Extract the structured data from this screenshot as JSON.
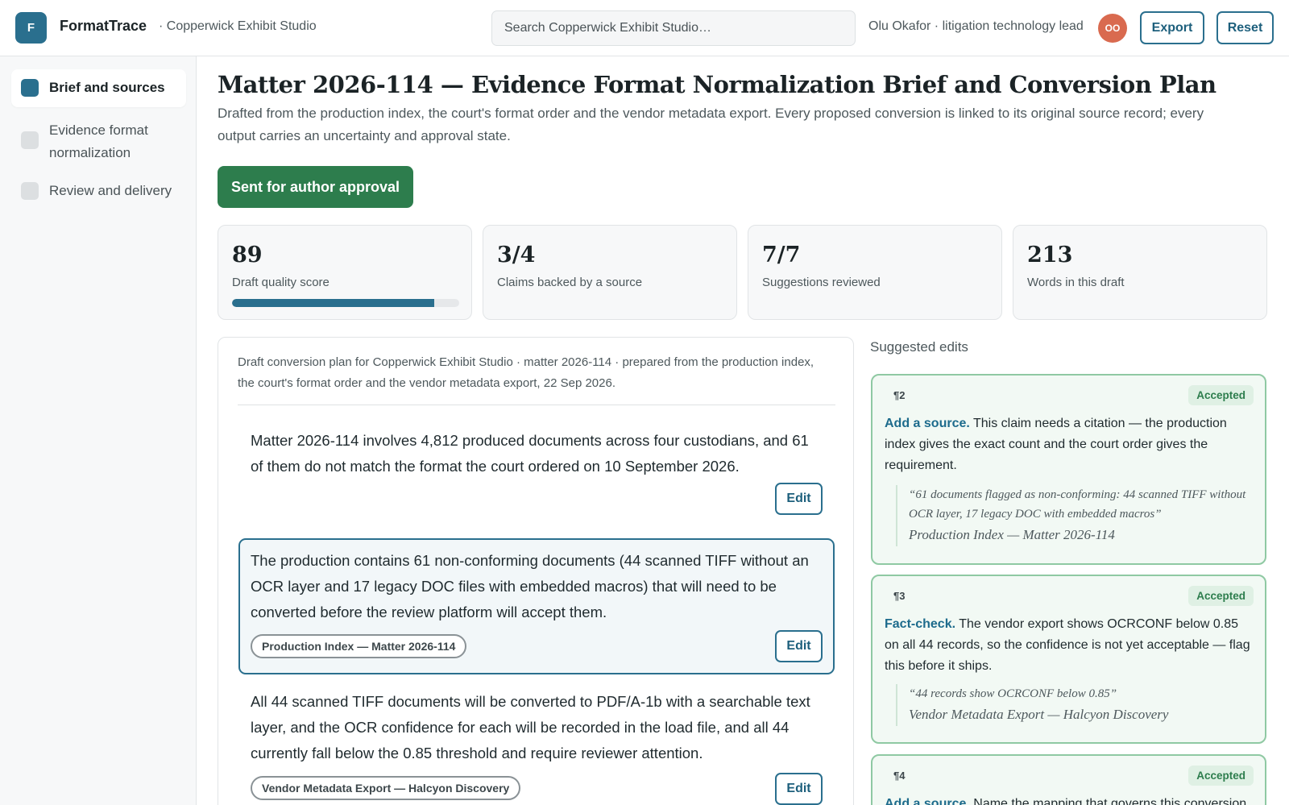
{
  "app": {
    "logo_letter": "F",
    "name": "FormatTrace",
    "workspace": "· Copperwick Exhibit Studio",
    "search_placeholder": "Search Copperwick Exhibit Studio…",
    "user": "Olu Okafor · litigation technology lead",
    "avatar_initials": "OO",
    "export_label": "Export",
    "reset_label": "Reset"
  },
  "sidebar": {
    "items": [
      {
        "label": "Brief and sources",
        "active": true
      },
      {
        "label": "Evidence format normalization",
        "active": false
      },
      {
        "label": "Review and delivery",
        "active": false
      }
    ]
  },
  "page": {
    "title": "Matter 2026-114 — Evidence Format Normalization Brief and Conversion Plan",
    "subtitle": "Drafted from the production index, the court's format order and the vendor metadata export. Every proposed conversion is linked to its original source record; every output carries an uncertainty and approval state.",
    "status_button": "Sent for author approval"
  },
  "stats": [
    {
      "value": "89",
      "label": "Draft quality score",
      "progress": 0.89
    },
    {
      "value": "3/4",
      "label": "Claims backed by a source"
    },
    {
      "value": "7/7",
      "label": "Suggestions reviewed"
    },
    {
      "value": "213",
      "label": "Words in this draft"
    }
  ],
  "document": {
    "header": "Draft conversion plan for Copperwick Exhibit Studio · matter 2026-114 · prepared from the production index, the court's format order and the vendor metadata export, 22 Sep 2026.",
    "edit_label": "Edit",
    "paragraphs": [
      {
        "text": "Matter 2026-114 involves 4,812 produced documents across four custodians, and 61 of them do not match the format the court ordered on 10 September 2026.",
        "source": ""
      },
      {
        "text": "The production contains 61 non-conforming documents (44 scanned TIFF without an OCR layer and 17 legacy DOC files with embedded macros) that will need to be converted before the review platform will accept them.",
        "source": "Production Index — Matter 2026-114"
      },
      {
        "text": "All 44 scanned TIFF documents will be converted to PDF/A-1b with a searchable text layer, and the OCR confidence for each will be recorded in the load file, and all 44 currently fall below the 0.85 threshold and require reviewer attention.",
        "source": "Vendor Metadata Export — Halcyon Discovery"
      }
    ]
  },
  "suggestions": {
    "heading": "Suggested edits",
    "cards": [
      {
        "para": "¶2",
        "status": "Accepted",
        "kind": "Add a source.",
        "body": "This claim needs a citation — the production index gives the exact count and the court order gives the requirement.",
        "quote": "“61 documents flagged as non-conforming: 44 scanned TIFF without OCR layer, 17 legacy DOC with embedded macros”",
        "source": "Production Index — Matter 2026-114"
      },
      {
        "para": "¶3",
        "status": "Accepted",
        "kind": "Fact-check.",
        "body": "The vendor export shows OCRCONF below 0.85 on all 44 records, so the confidence is not yet acceptable — flag this before it ships.",
        "quote": "“44 records show OCRCONF below 0.85”",
        "source": "Vendor Metadata Export — Halcyon Discovery"
      },
      {
        "para": "¶4",
        "status": "Accepted",
        "kind": "Add a source.",
        "body": "Name the mapping that governs this conversion"
      }
    ]
  }
}
